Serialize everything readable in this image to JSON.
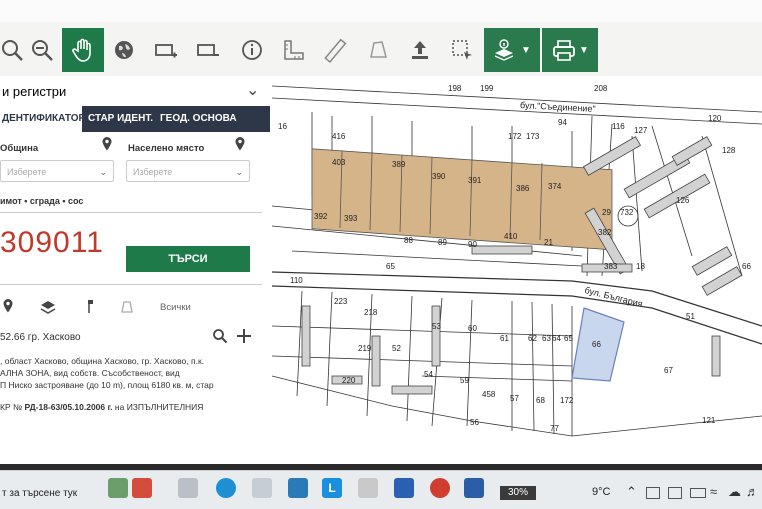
{
  "toolbar": {
    "tools": [
      "zoom-in-icon",
      "zoom-out-icon",
      "hand-pan-icon",
      "globe-icon",
      "add-layer-icon",
      "remove-layer-icon",
      "info-icon",
      "measure-ruler-icon",
      "measure-line-icon",
      "polygon-area-icon",
      "upload-icon",
      "select-area-icon",
      "layers-info-icon",
      "print-icon"
    ]
  },
  "panel": {
    "register_select": "и регистри",
    "tabs": [
      "ДЕНТИФИКАТОР",
      "СТАР ИДЕНТ.",
      "ГЕОД. ОСНОВА"
    ],
    "municipality_label": "Община",
    "municipality_placeholder": "Изберете",
    "settlement_label": "Населено място",
    "settlement_placeholder": "Изберете",
    "object_types": "имот • сграда • сос",
    "identifier_value": "309011",
    "search_button": "ТЪРСИ",
    "filter_all": "Всички",
    "result_title": "52.66 гр. Хасково",
    "result_line1": ", област Хасково, община Хасково, гр. Хасково, п.к.",
    "result_line2": "АЛНА ЗОНА, вид собств. Съсобственост, вид",
    "result_line3": "П Ниско застрояване (до 10 m), площ 6180 кв. м, стар",
    "result_order_prefix": "КР № ",
    "result_order_number": "РД-18-63/05.10.2006 г.",
    "result_order_suffix": " на ИЗПЪЛНИТЕЛНИЯ"
  },
  "map": {
    "street_saedinenie": "бул.\"Съединение\"",
    "street_bulgaria": "бул. България",
    "labels": [
      "198",
      "199",
      "208",
      "120",
      "116",
      "127",
      "128",
      "16",
      "416",
      "172",
      "173",
      "94",
      "392",
      "393",
      "88",
      "89",
      "90",
      "410",
      "21",
      "382",
      "383",
      "18",
      "65",
      "110",
      "223",
      "218",
      "53",
      "60",
      "61",
      "62",
      "63",
      "64",
      "65",
      "66",
      "67",
      "121",
      "219",
      "52",
      "59",
      "220",
      "54",
      "458",
      "57",
      "68",
      "172",
      "56",
      "77",
      "403",
      "389",
      "390",
      "391",
      "386",
      "374",
      "29",
      "732",
      "126",
      "66",
      "51"
    ]
  },
  "taskbar": {
    "search_text": "т за търсене тук",
    "battery": "30%",
    "temperature": "9°C"
  }
}
